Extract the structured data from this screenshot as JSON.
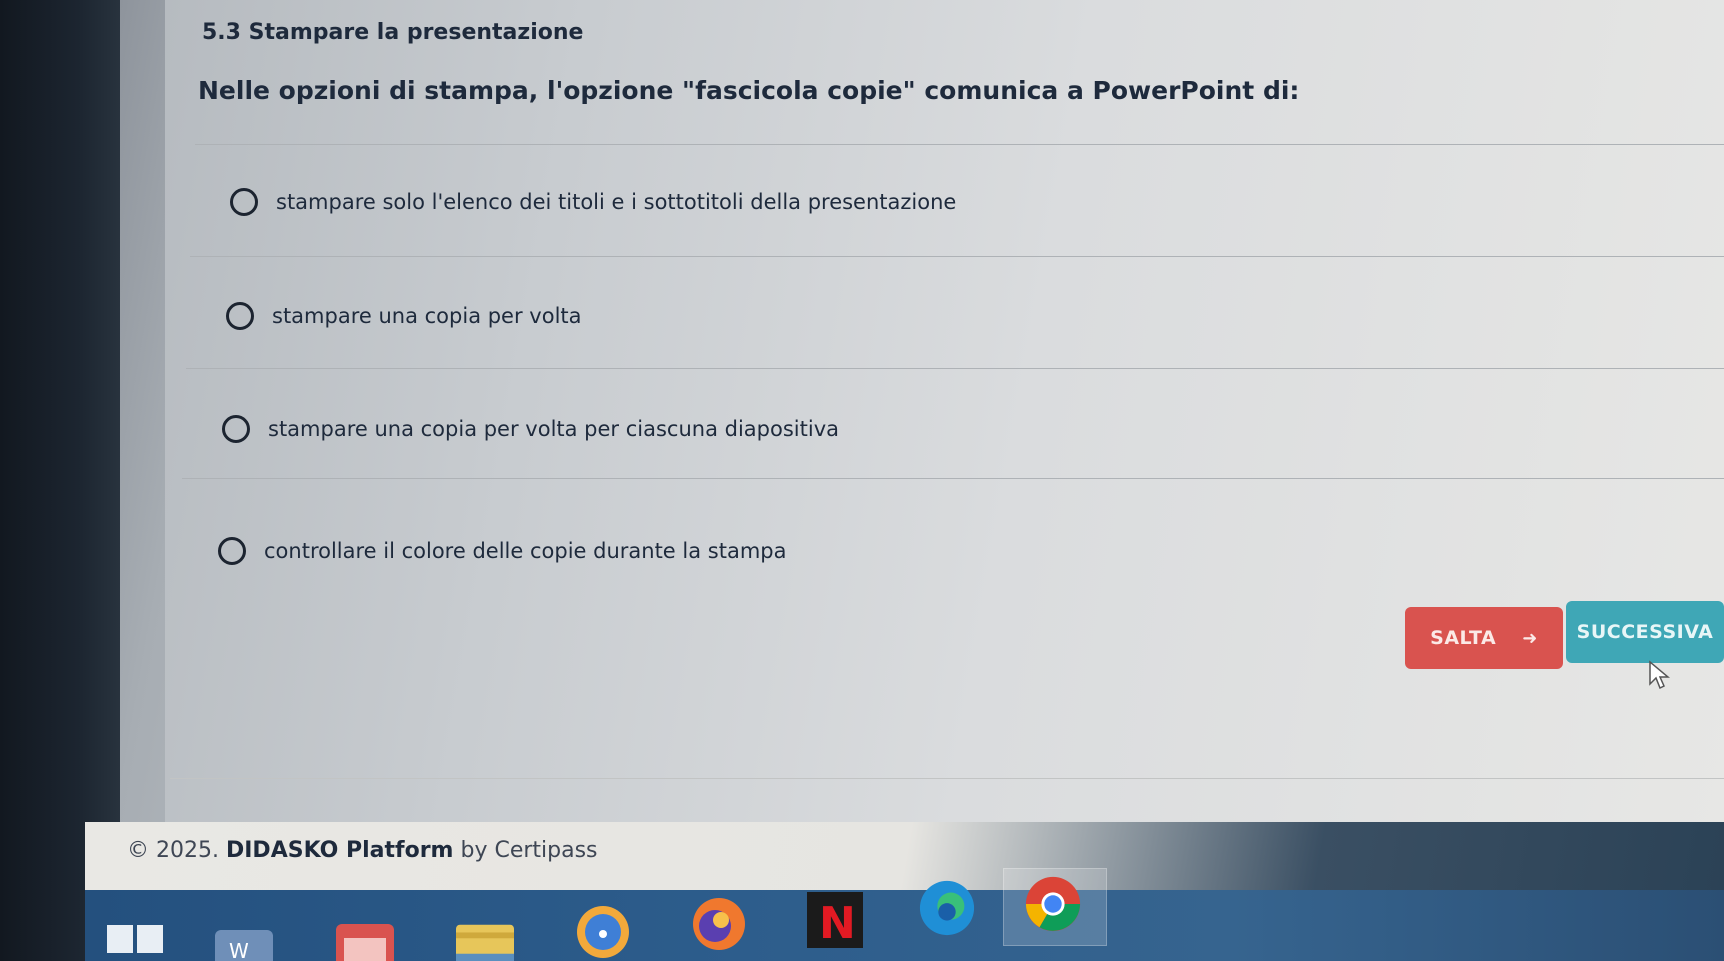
{
  "section": {
    "title": "5.3 Stampare la presentazione"
  },
  "question": {
    "text": "Nelle opzioni di stampa, l'opzione \"fascicola copie\" comunica a PowerPoint di:"
  },
  "options": [
    {
      "label": "stampare solo l'elenco dei titoli e i sottotitoli della presentazione",
      "selected": false
    },
    {
      "label": "stampare una copia per volta",
      "selected": false
    },
    {
      "label": "stampare una copia per volta per ciascuna diapositiva",
      "selected": false
    },
    {
      "label": "controllare il colore delle copie durante la stampa",
      "selected": false
    }
  ],
  "buttons": {
    "skip_label": "SALTA",
    "next_label": "SUCCESSIVA"
  },
  "footer": {
    "copyright": "© 2025.",
    "brand": "DIDASKO Platform",
    "by": "by Certipass"
  },
  "colors": {
    "skip_button": "#d9534f",
    "next_button": "#3fa7b6",
    "text": "#1e2a3c"
  },
  "taskbar": {
    "icons": [
      "windows-start-icon",
      "word-icon",
      "calendar-icon",
      "file-explorer-icon",
      "edge-legacy-icon",
      "firefox-icon",
      "netflix-icon",
      "edge-icon",
      "chrome-icon"
    ],
    "active": "chrome-icon"
  }
}
